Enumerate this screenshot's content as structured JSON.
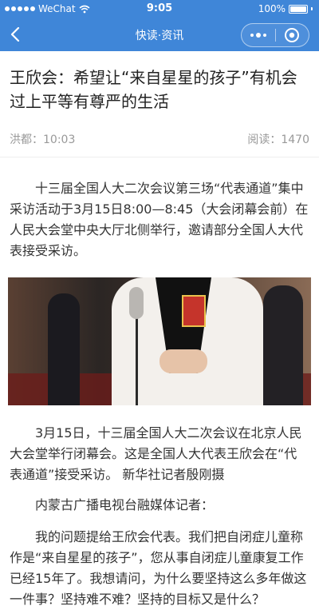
{
  "status_bar": {
    "carrier": "WeChat",
    "time": "9:05",
    "battery": "100%"
  },
  "nav": {
    "title": "快读·资讯"
  },
  "article": {
    "title": "王欣会：希望让“来自星星的孩子”有机会过上平等有尊严的生活",
    "source": "洪都：10:03",
    "reads": "阅读：1470",
    "paragraph_1": "十三届全国人大二次会议第三场“代表通道”集中采访活动于3月15日8:00—8:45（大会闭幕会前）在人民大会堂中央大厅北侧举行，邀请部分全国人大代表接受采访。",
    "photo_caption": "3月15日，十三届全国人大二次会议在北京人民大会堂举行闭幕会。这是全国人大代表王欣会在“代表通道”接受采访。 新华社记者殷刚摄",
    "paragraph_2": "内蒙古广播电视台融媒体记者：",
    "paragraph_3": "我的问题提给王欣会代表。我们把自闭症儿童称作是“来自星星的孩子”，您从事自闭症儿童康复工作已经15年了。我想请问，为什么要坚持这么多年做这一件事？坚持难不难？坚持的目标又是什么？"
  },
  "colors": {
    "nav_bg": "#3f86d8",
    "text": "#333333",
    "meta": "#999999"
  }
}
